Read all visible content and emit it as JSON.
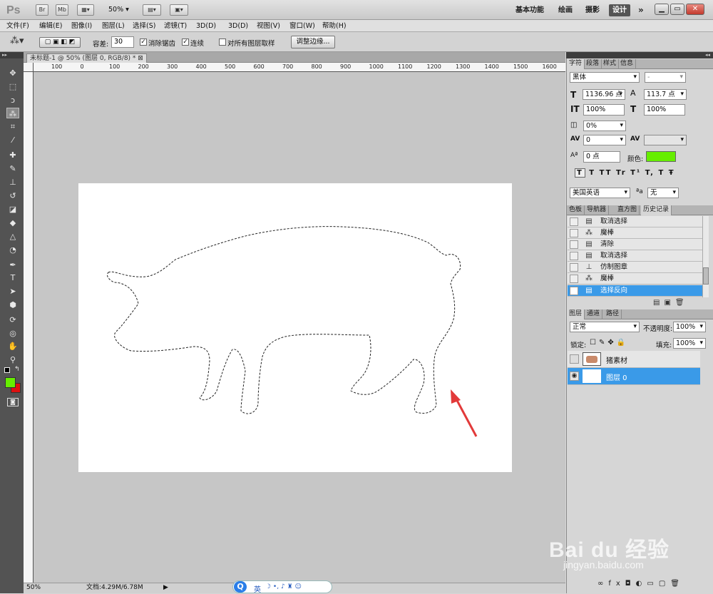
{
  "appbar": {
    "logo": "Ps",
    "br": "Br",
    "mb": "Mb",
    "zoom": "50%",
    "workspaces": [
      "基本功能",
      "绘画",
      "摄影",
      "设计"
    ],
    "active_workspace": "设计",
    "more": "»"
  },
  "menu": [
    "文件(F)",
    "编辑(E)",
    "图像(I)",
    "图层(L)",
    "选择(S)",
    "滤镜(T)",
    "3D(D)",
    "视图(V)",
    "窗口(W)",
    "帮助(H)"
  ],
  "options": {
    "tolerance_label": "容差:",
    "tolerance_value": "30",
    "antialias_label": "消除锯齿",
    "contiguous_label": "连续",
    "sample_all_label": "对所有图层取样",
    "refine_button": "调整边缘..."
  },
  "document": {
    "tab_title": "未标题-1 @ 50% (图层 0, RGB/8) *",
    "ruler_top": [
      "100",
      "0",
      "100",
      "200",
      "300",
      "400",
      "500",
      "600",
      "700",
      "800",
      "900",
      "1000",
      "1100",
      "1200",
      "1300",
      "1400",
      "1500",
      "1600"
    ],
    "status_zoom": "50%",
    "status_doc": "文档:4.29M/6.78M"
  },
  "colors": {
    "foreground": "#66ee00",
    "background": "#dd1111",
    "highlight": "#3a9ae8",
    "arrow": "#e23a3a"
  },
  "character_panel": {
    "tabs": [
      "字符",
      "段落",
      "样式",
      "信息"
    ],
    "font_family": "黑体",
    "font_style": "-",
    "font_size": "1136.96 点",
    "leading": "113.7 点",
    "vscale": "100%",
    "hscale": "100%",
    "tracking_ratio": "0%",
    "kerning": "0",
    "baseline": "0 点",
    "color_label": "颜色:",
    "language": "美国英语",
    "antialias": "无"
  },
  "history_panel": {
    "tabs": [
      "色板",
      "导航器",
      "直方图",
      "历史记录"
    ],
    "items": [
      {
        "label": "取消选择",
        "icon": "document-icon"
      },
      {
        "label": "魔棒",
        "icon": "magic-wand-icon"
      },
      {
        "label": "清除",
        "icon": "document-icon"
      },
      {
        "label": "取消选择",
        "icon": "document-icon"
      },
      {
        "label": "仿制图章",
        "icon": "stamp-icon"
      },
      {
        "label": "魔棒",
        "icon": "magic-wand-icon"
      },
      {
        "label": "选择反向",
        "icon": "document-icon"
      }
    ]
  },
  "layers_panel": {
    "tabs": [
      "图层",
      "通道",
      "路径"
    ],
    "blend_mode": "正常",
    "opacity_label": "不透明度:",
    "opacity": "100%",
    "lock_label": "锁定:",
    "fill_label": "填充:",
    "fill": "100%",
    "layers": [
      {
        "name": "猪素材",
        "visible": false,
        "selected": false
      },
      {
        "name": "图层 0",
        "visible": true,
        "selected": true
      }
    ]
  },
  "watermark": {
    "brand": "Bai du 经验",
    "url": "jingyan.baidu.com"
  },
  "ime": {
    "lang": "英"
  }
}
